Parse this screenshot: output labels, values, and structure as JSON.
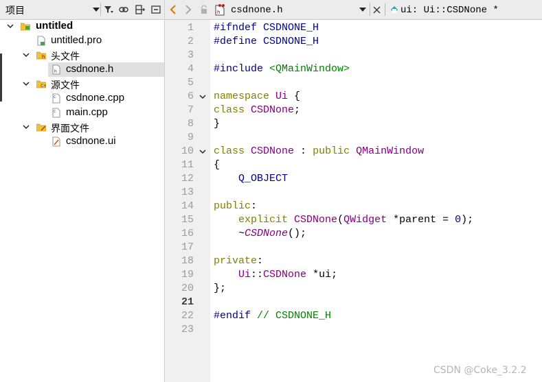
{
  "project_panel": {
    "title": "项目",
    "tree": [
      {
        "label": "untitled",
        "level": 0,
        "expanded": true,
        "bold": true,
        "icon": "qt-project-folder-icon"
      },
      {
        "label": "untitled.pro",
        "level": 1,
        "icon": "pro-file-icon"
      },
      {
        "label": "头文件",
        "level": 1,
        "expanded": true,
        "icon": "header-folder-icon"
      },
      {
        "label": "csdnone.h",
        "level": 2,
        "selected": true,
        "icon": "header-file-icon"
      },
      {
        "label": "源文件",
        "level": 1,
        "expanded": true,
        "icon": "source-folder-icon"
      },
      {
        "label": "csdnone.cpp",
        "level": 2,
        "icon": "cpp-file-icon"
      },
      {
        "label": "main.cpp",
        "level": 2,
        "icon": "cpp-file-icon"
      },
      {
        "label": "界面文件",
        "level": 1,
        "expanded": true,
        "icon": "forms-folder-icon"
      },
      {
        "label": "csdnone.ui",
        "level": 2,
        "icon": "ui-file-icon"
      }
    ]
  },
  "editor": {
    "file_name": "csdnone.h",
    "symbol": "ui: Ui::CSDNone *",
    "current_line": 21,
    "fold_lines": [
      6,
      10
    ],
    "lines": [
      "#ifndef CSDNONE_H",
      "#define CSDNONE_H",
      "",
      "#include <QMainWindow>",
      "",
      "namespace Ui {",
      "class CSDNone;",
      "}",
      "",
      "class CSDNone : public QMainWindow",
      "{",
      "    Q_OBJECT",
      "",
      "public:",
      "    explicit CSDNone(QWidget *parent = 0);",
      "    ~CSDNone();",
      "",
      "private:",
      "    Ui::CSDNone *ui;",
      "};",
      "",
      "#endif // CSDNONE_H",
      ""
    ]
  },
  "watermark": "CSDN @Coke_3.2.2",
  "colors": {
    "preprocessor": "#000080",
    "include_path": "#008000",
    "keyword": "#808000",
    "type": "#800080",
    "comment": "#008000"
  }
}
